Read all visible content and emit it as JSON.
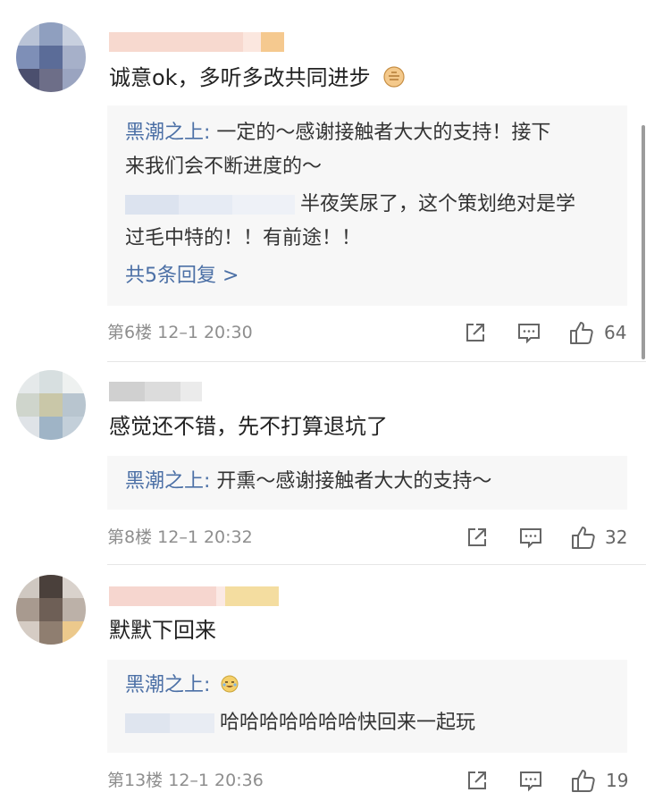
{
  "comments": [
    {
      "text": "诚意ok，多听多改共同进步",
      "emoji_icon": "fist-bump-emoji",
      "replies": [
        {
          "author": "黑潮之上",
          "sep": ":",
          "text_line1": " 一定的～感谢接触者大大的支持！接下",
          "text_line2": "来我们会不断进度的～"
        },
        {
          "blurred_author": true,
          "text_line1": "半夜笑尿了，这个策划绝对是学",
          "text_line2": "过毛中特的！！有前途！！"
        }
      ],
      "more": "共5条回复 >",
      "floor": "第6楼",
      "time": "12–1 20:30",
      "likes": "64"
    },
    {
      "text": "感觉还不错，先不打算退坑了",
      "replies": [
        {
          "author": "黑潮之上",
          "sep": ":",
          "text_line1": " 开熏～感谢接触者大大的支持～"
        }
      ],
      "floor": "第8楼",
      "time": "12–1 20:32",
      "likes": "32"
    },
    {
      "text": "默默下回来",
      "replies": [
        {
          "author": "黑潮之上",
          "sep": ":",
          "emoji_icon": "crying-laughing-emoji"
        },
        {
          "blurred_author": true,
          "text_line1": "哈哈哈哈哈哈哈快回来一起玩"
        }
      ],
      "floor": "第13楼",
      "time": "12–1 20:36",
      "likes": "19"
    }
  ],
  "icons": {
    "share": "share-icon",
    "comment": "comment-icon",
    "like": "thumbs-up-icon"
  },
  "colors": {
    "author": "#4c70a6",
    "reply_bg": "#f7f7f7",
    "meta": "#8e8e8e"
  }
}
